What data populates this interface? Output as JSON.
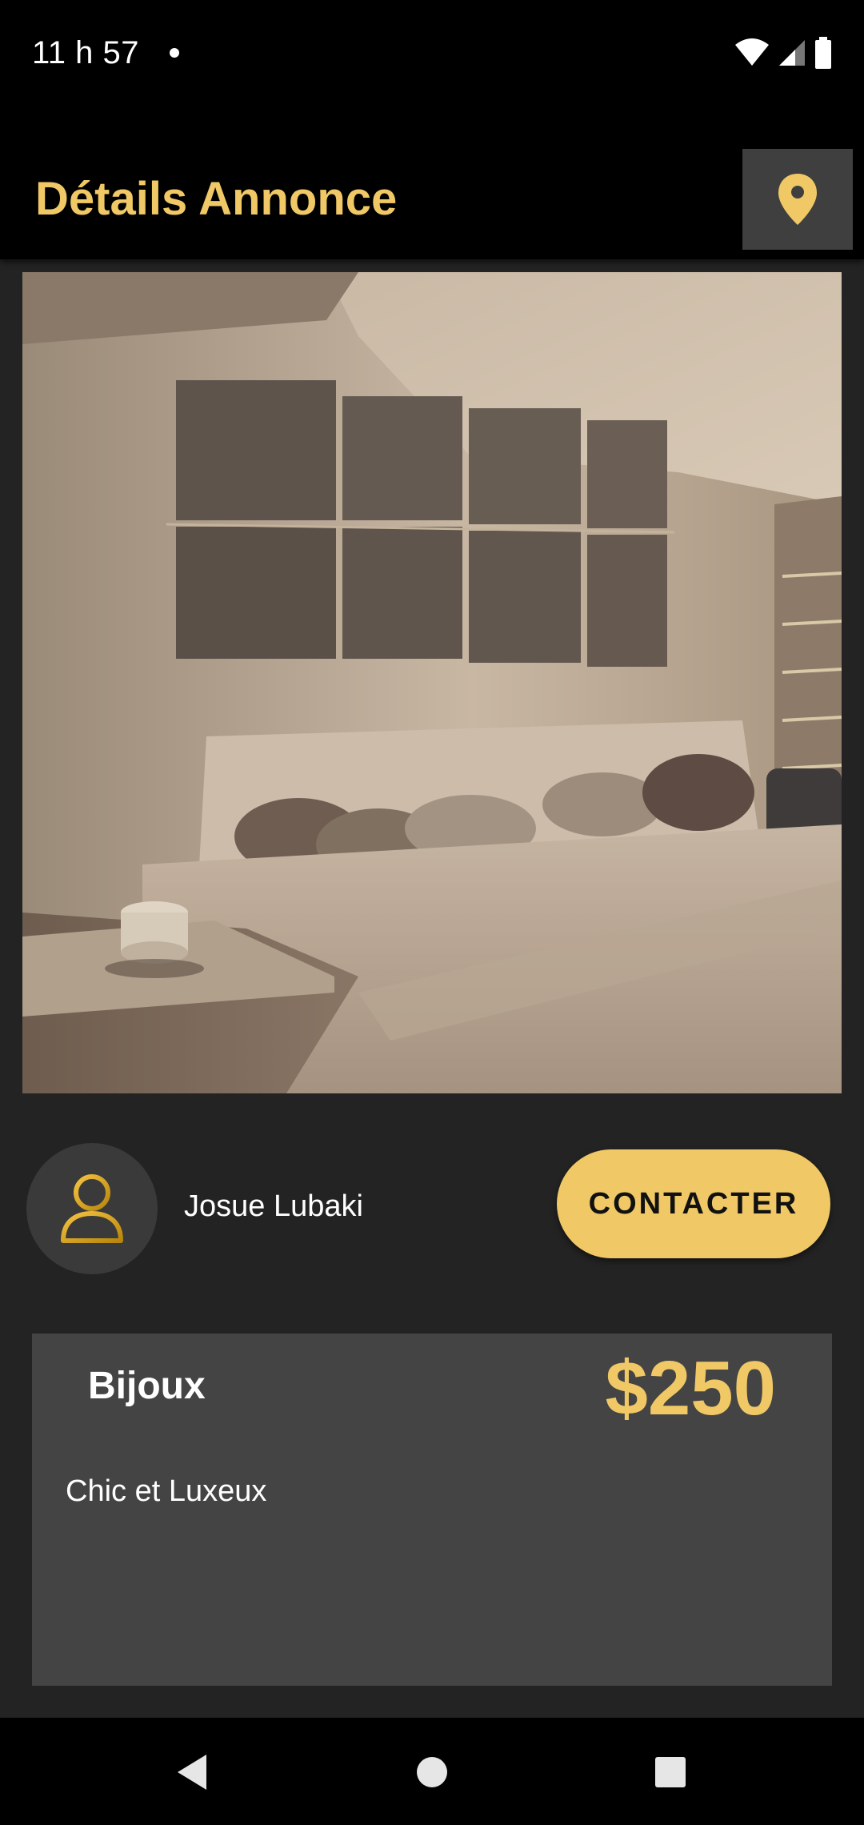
{
  "status_bar": {
    "time": "11 h 57",
    "icons": [
      "notification-dot",
      "wifi-icon",
      "signal-icon",
      "battery-icon"
    ]
  },
  "app_bar": {
    "title": "Détails Annonce",
    "action_icon": "location-pin-icon"
  },
  "listing": {
    "image_alt": "bedroom-photo",
    "seller_name": "Josue Lubaki",
    "contact_label": "CONTACTER",
    "category": "Bijoux",
    "price": "$250",
    "description": "Chic et Luxeux"
  },
  "nav_bar": {
    "buttons": [
      "back-icon",
      "home-icon",
      "recents-icon"
    ]
  },
  "colors": {
    "accent": "#f0c866",
    "background": "#232323",
    "card": "#444444",
    "bar": "#000000"
  }
}
